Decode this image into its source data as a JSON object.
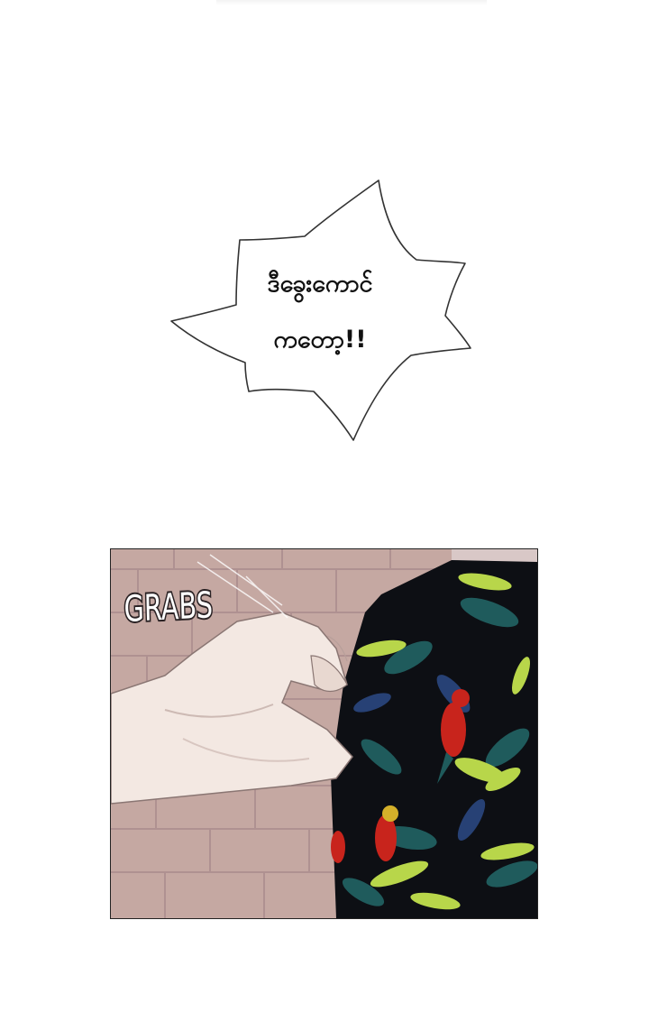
{
  "speech_bubble": {
    "line_1": "ဒီခွေးကောင်",
    "line_2": "ကတော့!!"
  },
  "panel": {
    "sfx": "GRABS"
  },
  "colors": {
    "background": "#ffffff",
    "bubble_fill": "#ffffff",
    "bubble_stroke": "#333333",
    "brick_wall": "#c5a8a2",
    "shirt_base": "#0d0f14",
    "leaf_green": "#b8d64a",
    "leaf_teal": "#1f5b5c",
    "parrot_red": "#c8241c",
    "skin": "#f3e8e2"
  }
}
